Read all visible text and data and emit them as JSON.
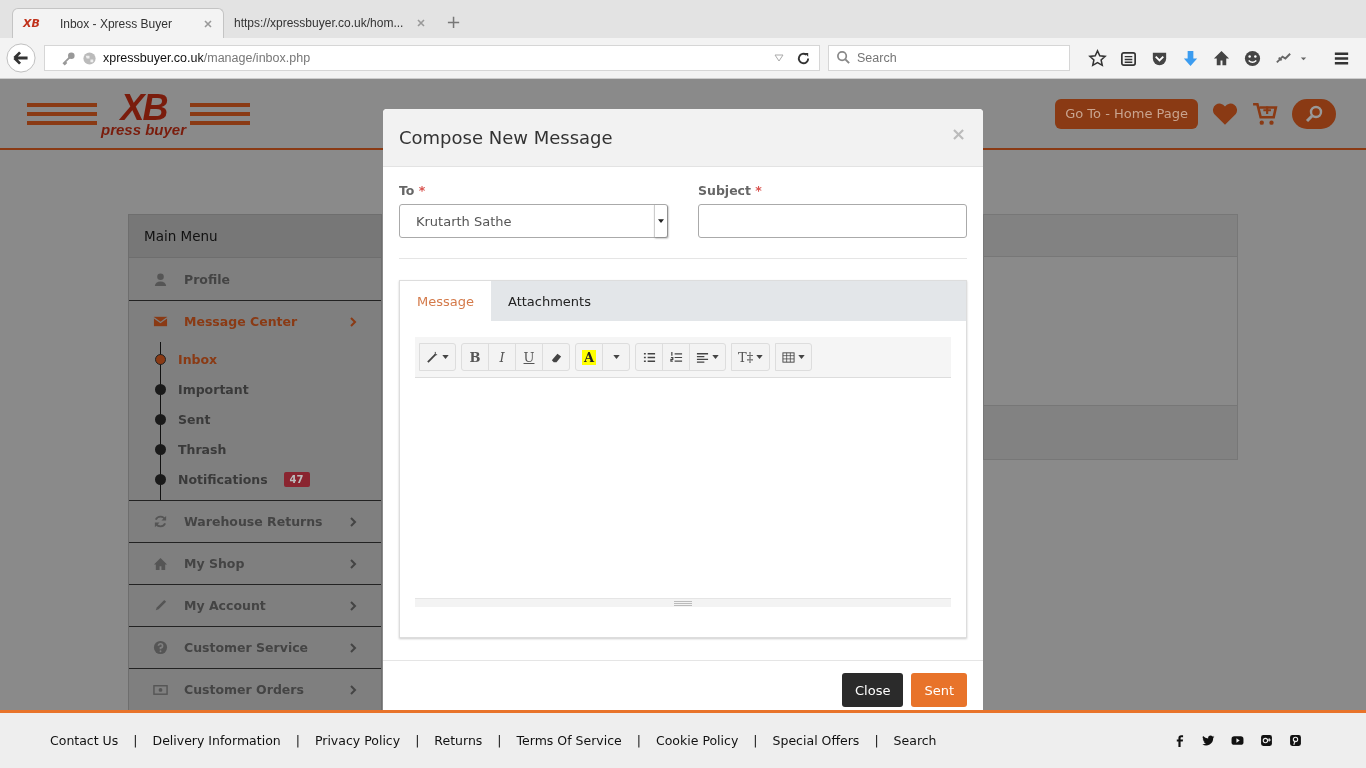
{
  "browser": {
    "tabs": [
      {
        "favicon": "XB",
        "title": "Inbox - Xpress Buyer",
        "selected": true
      },
      {
        "title": "https://xpressbuyer.co.uk/hom...",
        "selected": false
      }
    ],
    "new_tab": "+",
    "url": {
      "host": "xpressbuyer.co.uk",
      "path": "/manage/inbox.php"
    },
    "search": {
      "placeholder": "Search"
    }
  },
  "header": {
    "logo": {
      "mark": "XB",
      "text": "press buyer"
    },
    "home_button": "Go To - Home Page"
  },
  "sidebar": {
    "title": "Main Menu",
    "items": [
      {
        "label": "Profile",
        "selected": false,
        "expandable": false
      },
      {
        "label": "Message Center",
        "selected": true,
        "expandable": true,
        "children": [
          {
            "label": "Inbox",
            "selected": true
          },
          {
            "label": "Important",
            "selected": false
          },
          {
            "label": "Sent",
            "selected": false
          },
          {
            "label": "Thrash",
            "selected": false
          },
          {
            "label": "Notifications",
            "selected": false,
            "badge": "47"
          }
        ]
      },
      {
        "label": "Warehouse Returns",
        "selected": false,
        "expandable": true
      },
      {
        "label": "My Shop",
        "selected": false,
        "expandable": true
      },
      {
        "label": "My Account",
        "selected": false,
        "expandable": true
      },
      {
        "label": "Customer Service",
        "selected": false,
        "expandable": true
      },
      {
        "label": "Customer Orders",
        "selected": false,
        "expandable": true
      }
    ]
  },
  "modal": {
    "title": "Compose New Message",
    "close": "×",
    "to": {
      "label": "To",
      "required_mark": "*",
      "value": "Krutarth Sathe"
    },
    "subject": {
      "label": "Subject",
      "required_mark": "*"
    },
    "tabs": [
      {
        "label": "Message",
        "selected": true
      },
      {
        "label": "Attachments",
        "selected": false
      }
    ],
    "toolbar": [
      [
        {
          "kind": "magic",
          "caret": true
        }
      ],
      [
        {
          "kind": "bold",
          "label": "B",
          "caret": false
        },
        {
          "kind": "italic",
          "label": "I",
          "caret": false
        },
        {
          "kind": "underline",
          "label": "U",
          "caret": false
        },
        {
          "kind": "eraser",
          "caret": false
        }
      ],
      [
        {
          "kind": "highlight",
          "label": "A",
          "caret": false
        },
        {
          "kind": "caret",
          "caret": true
        }
      ],
      [
        {
          "kind": "bullets",
          "caret": false
        },
        {
          "kind": "numbers",
          "caret": false
        },
        {
          "kind": "align",
          "caret": true
        }
      ],
      [
        {
          "kind": "fontsize",
          "label": "T‡",
          "caret": true
        }
      ],
      [
        {
          "kind": "table",
          "caret": true
        }
      ]
    ],
    "buttons": [
      {
        "label": "Close",
        "kind": "dark"
      },
      {
        "label": "Sent",
        "kind": "primary"
      }
    ]
  },
  "footer": {
    "separator": "|",
    "links": [
      "Contact Us",
      "Delivery Information",
      "Privacy Policy",
      "Returns",
      "Terms Of Service",
      "Cookie Policy",
      "Special Offers",
      "Search"
    ]
  }
}
